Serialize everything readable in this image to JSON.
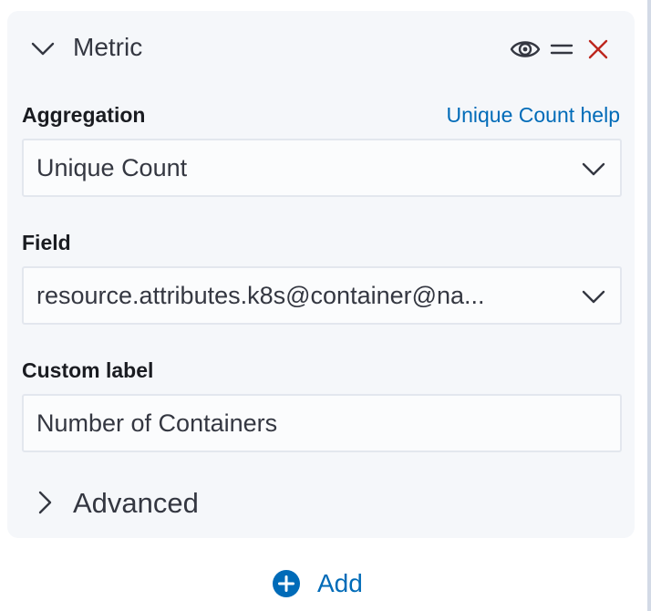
{
  "metric": {
    "title": "Metric",
    "icons": {
      "collapse": "chevron-down-icon",
      "toggle": "eye-icon",
      "drag": "drag-handle-icon",
      "remove": "close-icon"
    },
    "remove_color": "#bd271e"
  },
  "aggregation": {
    "label": "Aggregation",
    "help_link": "Unique Count help",
    "value": "Unique Count"
  },
  "field": {
    "label": "Field",
    "value": "resource.attributes.k8s@container@na..."
  },
  "custom_label": {
    "label": "Custom label",
    "value": "Number of Containers"
  },
  "advanced": {
    "label": "Advanced"
  },
  "add": {
    "label": "Add",
    "color": "#006bb8"
  }
}
